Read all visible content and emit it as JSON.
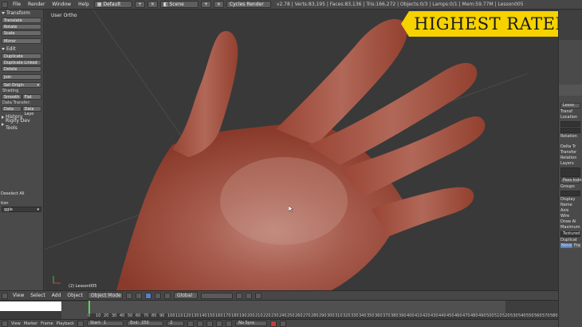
{
  "topbar": {
    "menus": [
      "File",
      "Render",
      "Window",
      "Help"
    ],
    "layout": "Default",
    "scene": "Scene",
    "engine": "Cycles Render",
    "stats": "v2.78 | Verts:83,195 | Faces:83,136 | Tris:166,272 | Objects:0/3 | Lamps:0/1 | Mem:59.77M | Lesson005"
  },
  "toolshelf": {
    "transform_header": "Transform",
    "translate": "Translate",
    "rotate": "Rotate",
    "scale": "Scale",
    "mirror": "Mirror",
    "edit_header": "Edit",
    "duplicate": "Duplicate",
    "duplicate_linked": "Duplicate Linked",
    "delete": "Delete",
    "join": "Join",
    "set_origin": "Set Origin",
    "shading_label": "Shading",
    "smooth": "Smooth",
    "flat": "Flat",
    "data_transfer_label": "Data Transfer:",
    "data": "Data",
    "data_layout": "Data Layo",
    "history": "History",
    "rigify": "Rigify Dev Tools",
    "deselect_all": "Deselect All",
    "action_label": "tion",
    "action_value": "ggle"
  },
  "viewport": {
    "title": "User Ortho",
    "object_label": "(2) Lesson005"
  },
  "banner": {
    "text": "HIGHEST RATED"
  },
  "props": {
    "lesson": "Lesso",
    "transform": "Transf",
    "location": "Location",
    "rotation": "Rotation",
    "delta": "Delta Tr",
    "transform2": "Transfor",
    "relations": "Relation",
    "layers": "Layers",
    "pass_index": "Pass Inde",
    "groups": "Groups",
    "display": "Display",
    "name": "Name",
    "axis": "Axis",
    "wire": "Wire",
    "draw_all": "Draw Al",
    "maximum": "Maximum",
    "textured": "Textured",
    "duplication": "Duplicat",
    "none": "None",
    "frames": "Fra"
  },
  "vpheader": {
    "view": "View",
    "select": "Select",
    "add": "Add",
    "object": "Object",
    "mode": "Object Mode",
    "orientation": "Global"
  },
  "timeline": {
    "ticks": [
      "0",
      "10",
      "20",
      "30",
      "40",
      "50",
      "60",
      "70",
      "80",
      "90",
      "100",
      "110",
      "120",
      "130",
      "140",
      "150",
      "160",
      "170",
      "180",
      "190",
      "200",
      "210",
      "220",
      "230",
      "240",
      "250",
      "260",
      "270",
      "280",
      "290",
      "300",
      "310",
      "320",
      "330",
      "340",
      "350",
      "360",
      "370",
      "380",
      "390",
      "400",
      "410",
      "420",
      "430",
      "440",
      "450",
      "460",
      "470",
      "480",
      "490",
      "500",
      "510",
      "520",
      "530",
      "540",
      "550",
      "560",
      "570",
      "580",
      "590"
    ]
  },
  "tlheader": {
    "view": "View",
    "marker": "Marker",
    "frame": "Frame",
    "playback": "Playback",
    "start": "Start:",
    "start_val": "1",
    "end": "End:",
    "end_val": "250",
    "current": "2",
    "sync": "No Sync"
  }
}
